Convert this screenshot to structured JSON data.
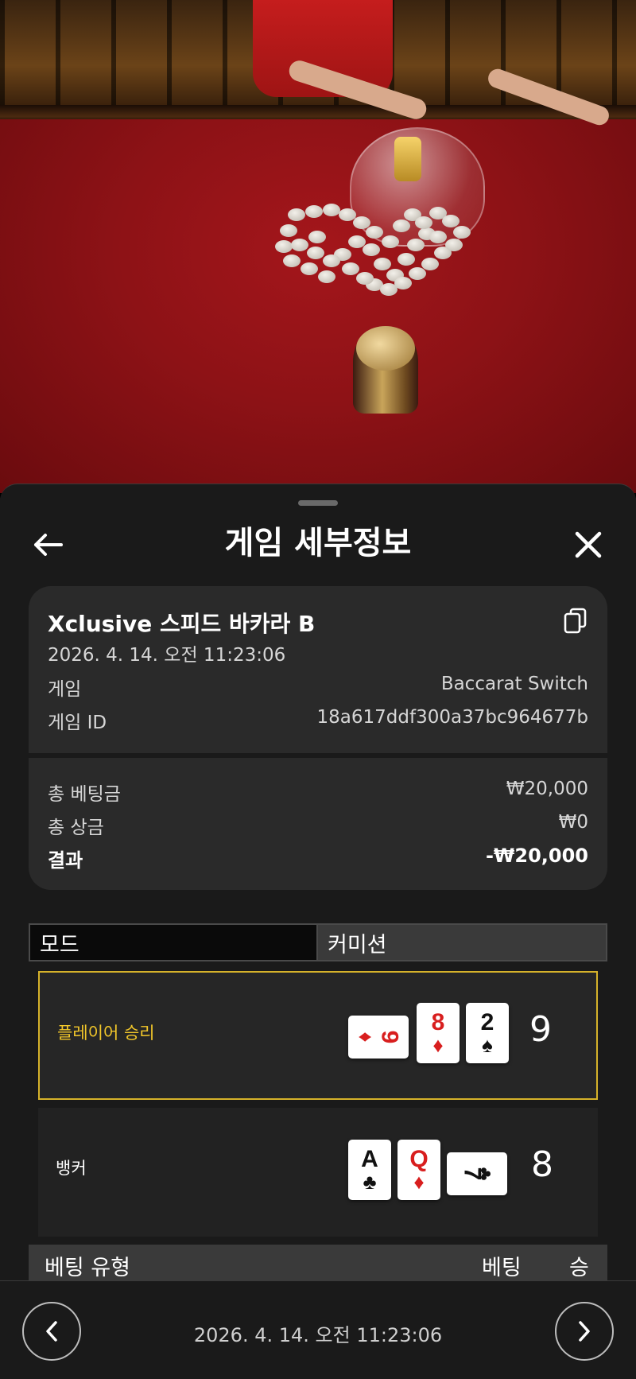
{
  "header": {
    "title": "게임 세부정보"
  },
  "game": {
    "name": "Xclusive 스피드 바카라 B",
    "datetime": "2026. 4. 14. 오전 11:23:06",
    "rows": [
      {
        "label": "게임",
        "value": "Baccarat Switch"
      },
      {
        "label": "게임 ID",
        "value": "18a617ddf300a37bc964677b"
      }
    ]
  },
  "summary": {
    "total_bet_label": "총 베팅금",
    "total_bet_value": "₩20,000",
    "total_win_label": "총 상금",
    "total_win_value": "₩0",
    "result_label": "결과",
    "result_value": "-₩20,000"
  },
  "modes": {
    "mode_label": "모드",
    "commission_label": "커미션"
  },
  "results": {
    "player": {
      "label": "플레이어 승리",
      "score": "9",
      "cards": [
        {
          "rank": "9",
          "suit": "♦",
          "color": "red",
          "orientation": "sideways"
        },
        {
          "rank": "8",
          "suit": "♦",
          "color": "red",
          "orientation": "upright"
        },
        {
          "rank": "2",
          "suit": "♠",
          "color": "black",
          "orientation": "upright"
        }
      ]
    },
    "banker": {
      "label": "뱅커",
      "score": "8",
      "cards": [
        {
          "rank": "A",
          "suit": "♣",
          "color": "black",
          "orientation": "upright"
        },
        {
          "rank": "Q",
          "suit": "♦",
          "color": "red",
          "orientation": "upright"
        },
        {
          "rank": "7",
          "suit": "♣",
          "color": "black",
          "orientation": "sideways"
        }
      ]
    }
  },
  "bets_table": {
    "col_type": "베팅 유형",
    "col_bet": "베팅",
    "col_win": "승"
  },
  "footer": {
    "datetime": "2026. 4. 14. 오전 11:23:06"
  },
  "colors": {
    "accent": "#f2c72a",
    "card_red": "#d81e1e",
    "sheet_bg": "#1a1a1a",
    "card_bg": "#2a2a2a"
  }
}
